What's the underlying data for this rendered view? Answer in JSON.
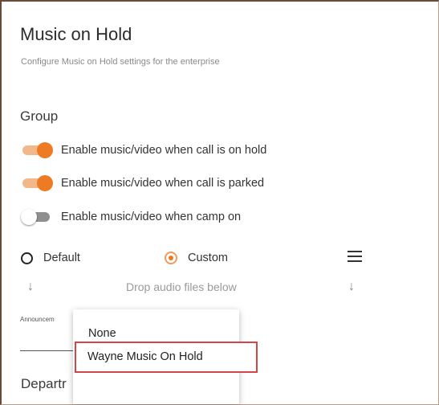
{
  "header": {
    "title": "Music on Hold",
    "subtitle": "Configure Music on Hold settings for the enterprise"
  },
  "group": {
    "heading": "Group",
    "toggles": [
      {
        "label": "Enable music/video when call is on hold",
        "on": true
      },
      {
        "label": "Enable music/video when call is parked",
        "on": true
      },
      {
        "label": "Enable music/video when camp on",
        "on": false
      }
    ]
  },
  "source": {
    "options": [
      {
        "label": "Default",
        "selected": false
      },
      {
        "label": "Custom",
        "selected": true
      }
    ],
    "drop_text": "Drop audio files below",
    "announcement_label": "Announcem"
  },
  "dropdown": {
    "options": [
      "None",
      "Wayne Music On Hold"
    ],
    "highlighted": "Wayne Music On Hold"
  },
  "department": {
    "heading": "Departr"
  },
  "colors": {
    "accent": "#ee7b24",
    "accent_light": "#f2b88a",
    "highlight_border": "#d64545"
  },
  "icons": {
    "menu": "hamburger-menu-icon",
    "arrow_left": "arrow-down-icon",
    "arrow_right": "arrow-down-icon"
  }
}
